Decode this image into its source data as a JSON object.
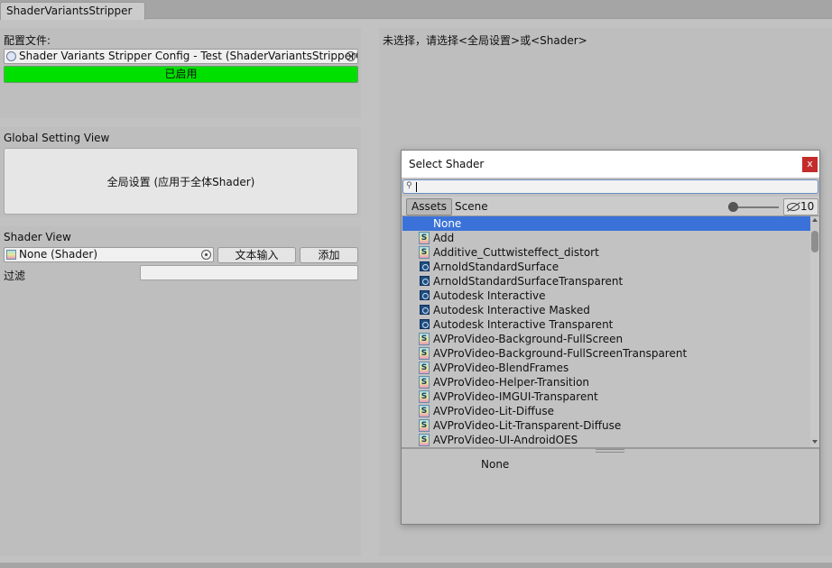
{
  "window": {
    "tab_title": "ShaderVariantsStripper"
  },
  "config": {
    "label": "配置文件:",
    "field_value": "Shader Variants Stripper Config - Test (ShaderVariantsStripperC",
    "status": "已启用",
    "status_color": "#00e000"
  },
  "global": {
    "section_title": "Global Setting View",
    "button_label": "全局设置 (应用于全体Shader)"
  },
  "shader_view": {
    "section_title": "Shader View",
    "field_value": "None (Shader)",
    "text_input_button": "文本输入",
    "add_button": "添加",
    "filter_label": "过滤",
    "filter_value": ""
  },
  "right_panel": {
    "hint": "未选择，请选择<全局设置>或<Shader>"
  },
  "dialog": {
    "title": "Select Shader",
    "close": "x",
    "search_value": "",
    "tabs": [
      {
        "label": "Assets",
        "active": true
      },
      {
        "label": "Scene",
        "active": false
      }
    ],
    "hidden_count": "10",
    "items": [
      {
        "label": "None",
        "icon": "none",
        "selected": true
      },
      {
        "label": "Add",
        "icon": "shader"
      },
      {
        "label": "Additive_Cuttwisteffect_distort",
        "icon": "shader"
      },
      {
        "label": "ArnoldStandardSurface",
        "icon": "material"
      },
      {
        "label": "ArnoldStandardSurfaceTransparent",
        "icon": "material"
      },
      {
        "label": "Autodesk Interactive",
        "icon": "material"
      },
      {
        "label": "Autodesk Interactive Masked",
        "icon": "material"
      },
      {
        "label": "Autodesk Interactive Transparent",
        "icon": "material"
      },
      {
        "label": "AVProVideo-Background-FullScreen",
        "icon": "shader"
      },
      {
        "label": "AVProVideo-Background-FullScreenTransparent",
        "icon": "shader"
      },
      {
        "label": "AVProVideo-BlendFrames",
        "icon": "shader"
      },
      {
        "label": "AVProVideo-Helper-Transition",
        "icon": "shader"
      },
      {
        "label": "AVProVideo-IMGUI-Transparent",
        "icon": "shader"
      },
      {
        "label": "AVProVideo-Lit-Diffuse",
        "icon": "shader"
      },
      {
        "label": "AVProVideo-Lit-Transparent-Diffuse",
        "icon": "shader"
      },
      {
        "label": "AVProVideo-UI-AndroidOES",
        "icon": "shader"
      }
    ],
    "preview_label": "None"
  },
  "colors": {
    "selection": "#3a72d9",
    "close_button": "#c42b2b"
  }
}
